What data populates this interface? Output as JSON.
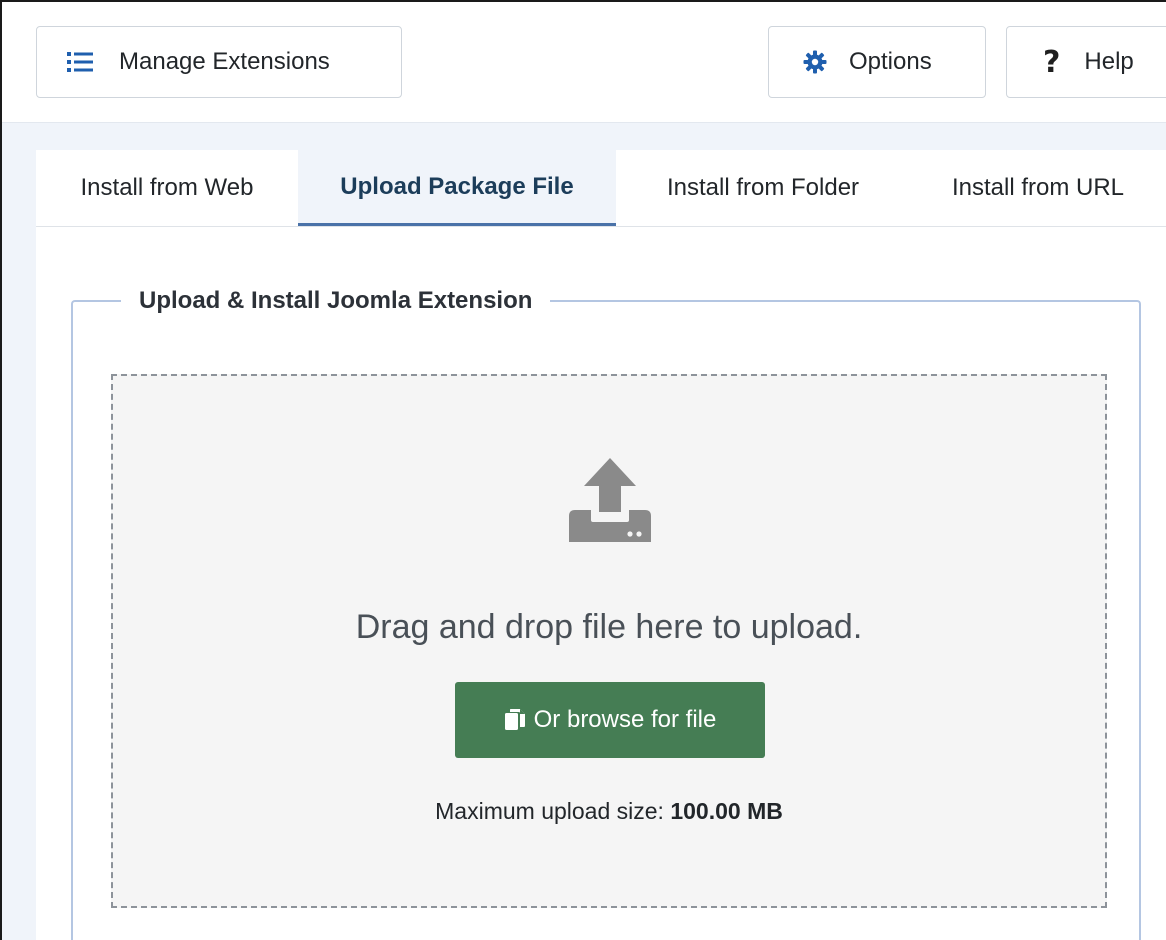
{
  "toolbar": {
    "manage_label": "Manage Extensions",
    "options_label": "Options",
    "help_label": "Help"
  },
  "tabs": [
    {
      "label": "Install from Web",
      "active": false
    },
    {
      "label": "Upload Package File",
      "active": true
    },
    {
      "label": "Install from Folder",
      "active": false
    },
    {
      "label": "Install from URL",
      "active": false
    }
  ],
  "upload": {
    "legend": "Upload & Install Joomla Extension",
    "drop_text": "Drag and drop file here to upload.",
    "browse_label": "Or browse for file",
    "max_size_label": "Maximum upload size:",
    "max_size_value": "100.00 MB"
  },
  "icons": {
    "manage": "list-icon",
    "options": "gear-icon",
    "help": "question-icon",
    "upload": "upload-icon",
    "browse": "copy-icon"
  },
  "colors": {
    "accent_tab": "#4a72a8",
    "browse_button": "#457d54",
    "options_icon": "#1f5fae",
    "manage_icon": "#1f5fae",
    "upload_icon": "#8a8a8a"
  }
}
